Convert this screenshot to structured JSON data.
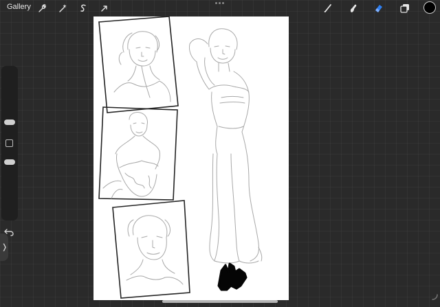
{
  "app": {
    "gallery_label": "Gallery"
  },
  "toolbar": {
    "left_tools": [
      "wrench-icon",
      "magic-wand-icon",
      "selection-icon",
      "transform-arrow-icon"
    ],
    "right_tools": [
      "brush-icon",
      "smudge-icon",
      "eraser-icon",
      "layers-icon"
    ],
    "active_tool": "eraser-icon",
    "active_color": "#000000",
    "accent_color": "#2f7ff0"
  },
  "sidebar": {
    "brush_size_level": 0.35,
    "opacity_level": 0.6,
    "buttons": [
      "modify-button",
      "undo-icon"
    ]
  }
}
